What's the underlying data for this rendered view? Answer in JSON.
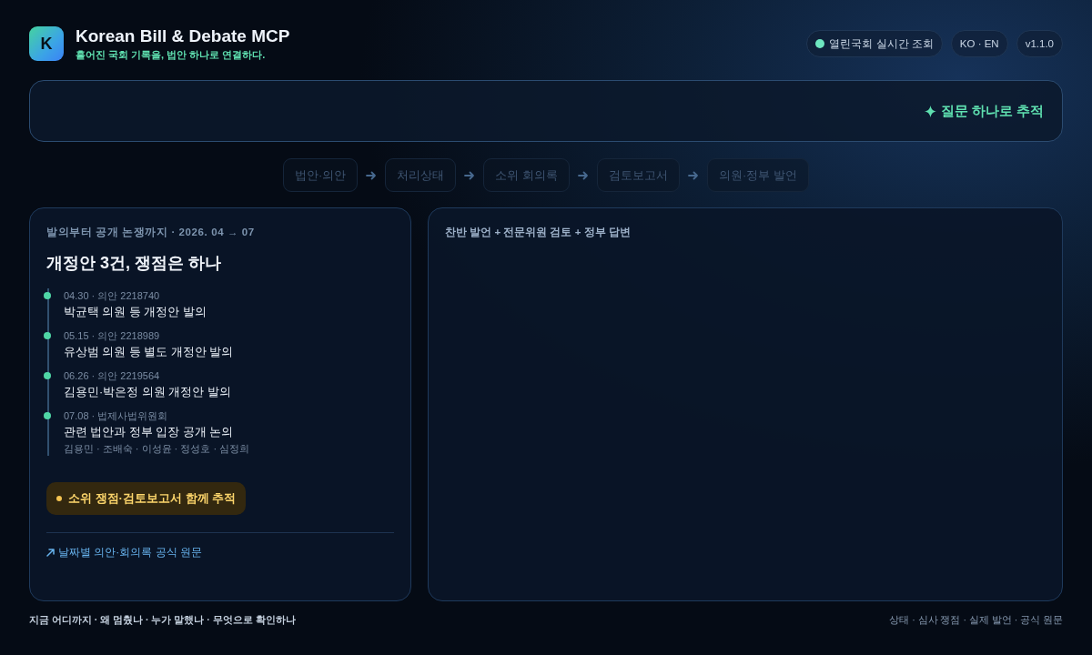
{
  "header": {
    "logo_letter": "K",
    "title": "Korean Bill & Debate MCP",
    "tagline": "흩어진 국회 기록을, 법안 하나로 연결하다.",
    "pills": [
      {
        "kind": "status",
        "label": "열린국회 실시간 조회"
      },
      {
        "kind": "plain",
        "label": "KO · EN"
      },
      {
        "kind": "plain",
        "label": "v1.1.0"
      }
    ]
  },
  "query": {
    "button": "질문 하나로 추적"
  },
  "steps": [
    "법안·의안",
    "처리상태",
    "소위 회의록",
    "검토보고서",
    "의원·정부 발언"
  ],
  "timeline_card": {
    "eyebrow": "발의부터 공개 논쟁까지 · 2026. 04 → 07",
    "title": "개정안 3건, 쟁점은 하나",
    "events": [
      {
        "meta": "04.30 · 의안 2218740",
        "title": "박균택 의원 등 개정안 발의"
      },
      {
        "meta": "05.15 · 의안 2218989",
        "title": "유상범 의원 등 별도 개정안 발의"
      },
      {
        "meta": "06.26 · 의안 2219564",
        "title": "김용민·박은정 의원 개정안 발의"
      },
      {
        "meta": "07.08 · 법제사법위원회",
        "title": "관련 법안과 정부 입장 공개 논의",
        "people": "김용민 · 조배숙 · 이성윤 · 정성호 · 심정희"
      }
    ],
    "badge": "소위 쟁점·검토보고서 함께 추적",
    "link": "날짜별 의안·회의록 공식 원문"
  },
  "debate_card": {
    "heading": "찬반 발언 + 전문위원 검토 + 정부 답변"
  },
  "footer": {
    "left": "지금 어디까지 · 왜 멈췄나 · 누가 말했나 · 무엇으로 확인하나",
    "right": "상태 · 심사 쟁점 · 실제 발언 · 공식 원문"
  }
}
